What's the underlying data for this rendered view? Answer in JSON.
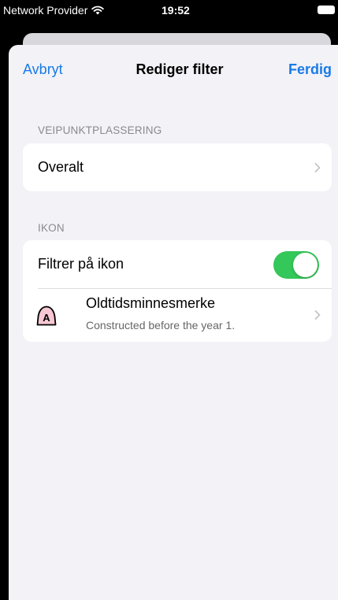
{
  "status_bar": {
    "carrier": "Network Provider",
    "time": "19:52"
  },
  "nav": {
    "cancel_label": "Avbryt",
    "title": "Rediger filter",
    "done_label": "Ferdig"
  },
  "sections": {
    "location": {
      "header": "VEIPUNKTPLASSERING",
      "value": "Overalt"
    },
    "icon": {
      "header": "IKON",
      "toggle_label": "Filtrer på ikon",
      "toggle_on": true,
      "item": {
        "letter": "A",
        "title": "Oldtidsminnesmerke",
        "subtitle": "Constructed before the year 1."
      }
    }
  },
  "colors": {
    "accent": "#1a7ae8",
    "toggle_on": "#34c759",
    "icon_fill": "#f7c7d3"
  }
}
